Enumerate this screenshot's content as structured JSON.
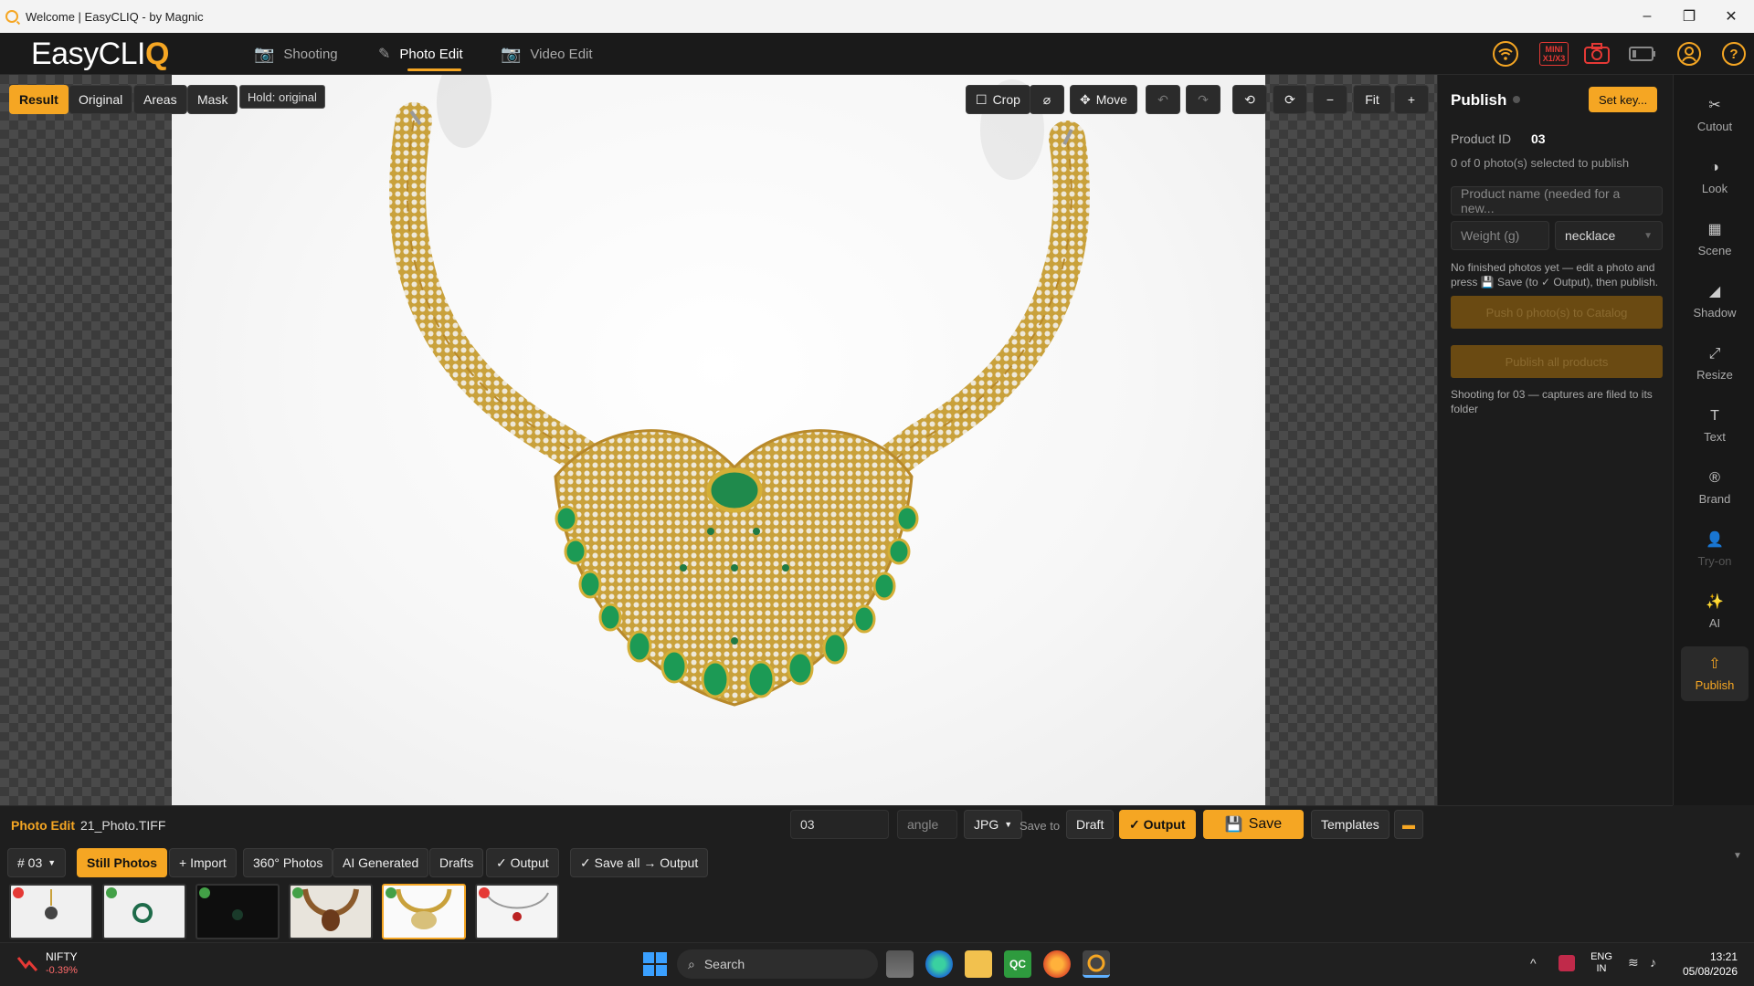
{
  "window": {
    "title": "Welcome | EasyCLIQ - by Magnic"
  },
  "header": {
    "logo_main": "EasyCLI",
    "logo_accent": "Q",
    "tabs": [
      {
        "label": "Shooting",
        "icon": "camera-icon"
      },
      {
        "label": "Photo Edit",
        "icon": "edit-icon"
      },
      {
        "label": "Video Edit",
        "icon": "video-camera-icon"
      }
    ],
    "mini_badge": "MINI\nX1/X3",
    "accent": "#f5a623"
  },
  "toolbar_left": {
    "result": "Result",
    "original": "Original",
    "areas": "Areas",
    "mask": "Mask",
    "hold": "Hold: original"
  },
  "toolbar_right": {
    "crop": "Crop",
    "move": "Move",
    "fit": "Fit",
    "zoom_out": "−",
    "zoom_in": "+",
    "reset_symbol": "⌀"
  },
  "publish_panel": {
    "title": "Publish",
    "set_key": "Set key...",
    "product_id_label": "Product ID",
    "product_id_value": "03",
    "selected_text": "0 of 0 photo(s) selected to publish",
    "product_name_placeholder": "Product name (needed for a new...",
    "weight_placeholder": "Weight (g)",
    "category_value": "necklace",
    "info_line1": "No finished photos yet — edit a photo and",
    "info_line2": "press 💾 Save (to ✓ Output), then publish.",
    "btn_push": "Push 0 photo(s) to Catalog",
    "btn_publish_all": "Publish all products",
    "shooting_note": "Shooting for 03 — captures are filed to its folder"
  },
  "right_rail": [
    {
      "label": "Cutout",
      "icon": "scissors-icon",
      "glyph": "✂"
    },
    {
      "label": "Look",
      "icon": "contrast-icon",
      "glyph": "◑"
    },
    {
      "label": "Scene",
      "icon": "scene-icon",
      "glyph": "▦"
    },
    {
      "label": "Shadow",
      "icon": "shadow-icon",
      "glyph": "◢"
    },
    {
      "label": "Resize",
      "icon": "resize-icon",
      "glyph": "⤢"
    },
    {
      "label": "Text",
      "icon": "text-icon",
      "glyph": "T"
    },
    {
      "label": "Brand",
      "icon": "brand-icon",
      "glyph": "®"
    },
    {
      "label": "Try-on",
      "icon": "person-icon",
      "glyph": "👤"
    },
    {
      "label": "AI",
      "icon": "sparkle-icon",
      "glyph": "✨"
    },
    {
      "label": "Publish",
      "icon": "publish-icon",
      "glyph": "⇧"
    }
  ],
  "status_bar": {
    "mode": "Photo Edit",
    "filename": "21_Photo.TIFF",
    "id_value": "03",
    "angle_placeholder": "angle",
    "format": "JPG",
    "save_to": "Save to",
    "draft": "Draft",
    "output": "✓ Output",
    "save": "Save",
    "templates": "Templates"
  },
  "filmstrip_bar": {
    "product_select": "# 03",
    "tabs": [
      "Still Photos",
      "+ Import",
      "360° Photos",
      "AI Generated",
      "Drafts",
      "✓ Output",
      "✓ Save all → Output"
    ],
    "thumbs": [
      {
        "status": "red",
        "color": "#e53935"
      },
      {
        "status": "green",
        "color": "#43a047"
      },
      {
        "status": "green",
        "color": "#43a047"
      },
      {
        "status": "green",
        "color": "#43a047"
      },
      {
        "status": "green",
        "color": "#43a047"
      },
      {
        "status": "red",
        "color": "#e53935"
      }
    ]
  },
  "taskbar": {
    "ticker_name": "NIFTY",
    "ticker_change": "-0.39%",
    "search": "Search",
    "lang1": "ENG",
    "lang2": "IN",
    "time": "13:21",
    "date": "05/08/2026"
  }
}
